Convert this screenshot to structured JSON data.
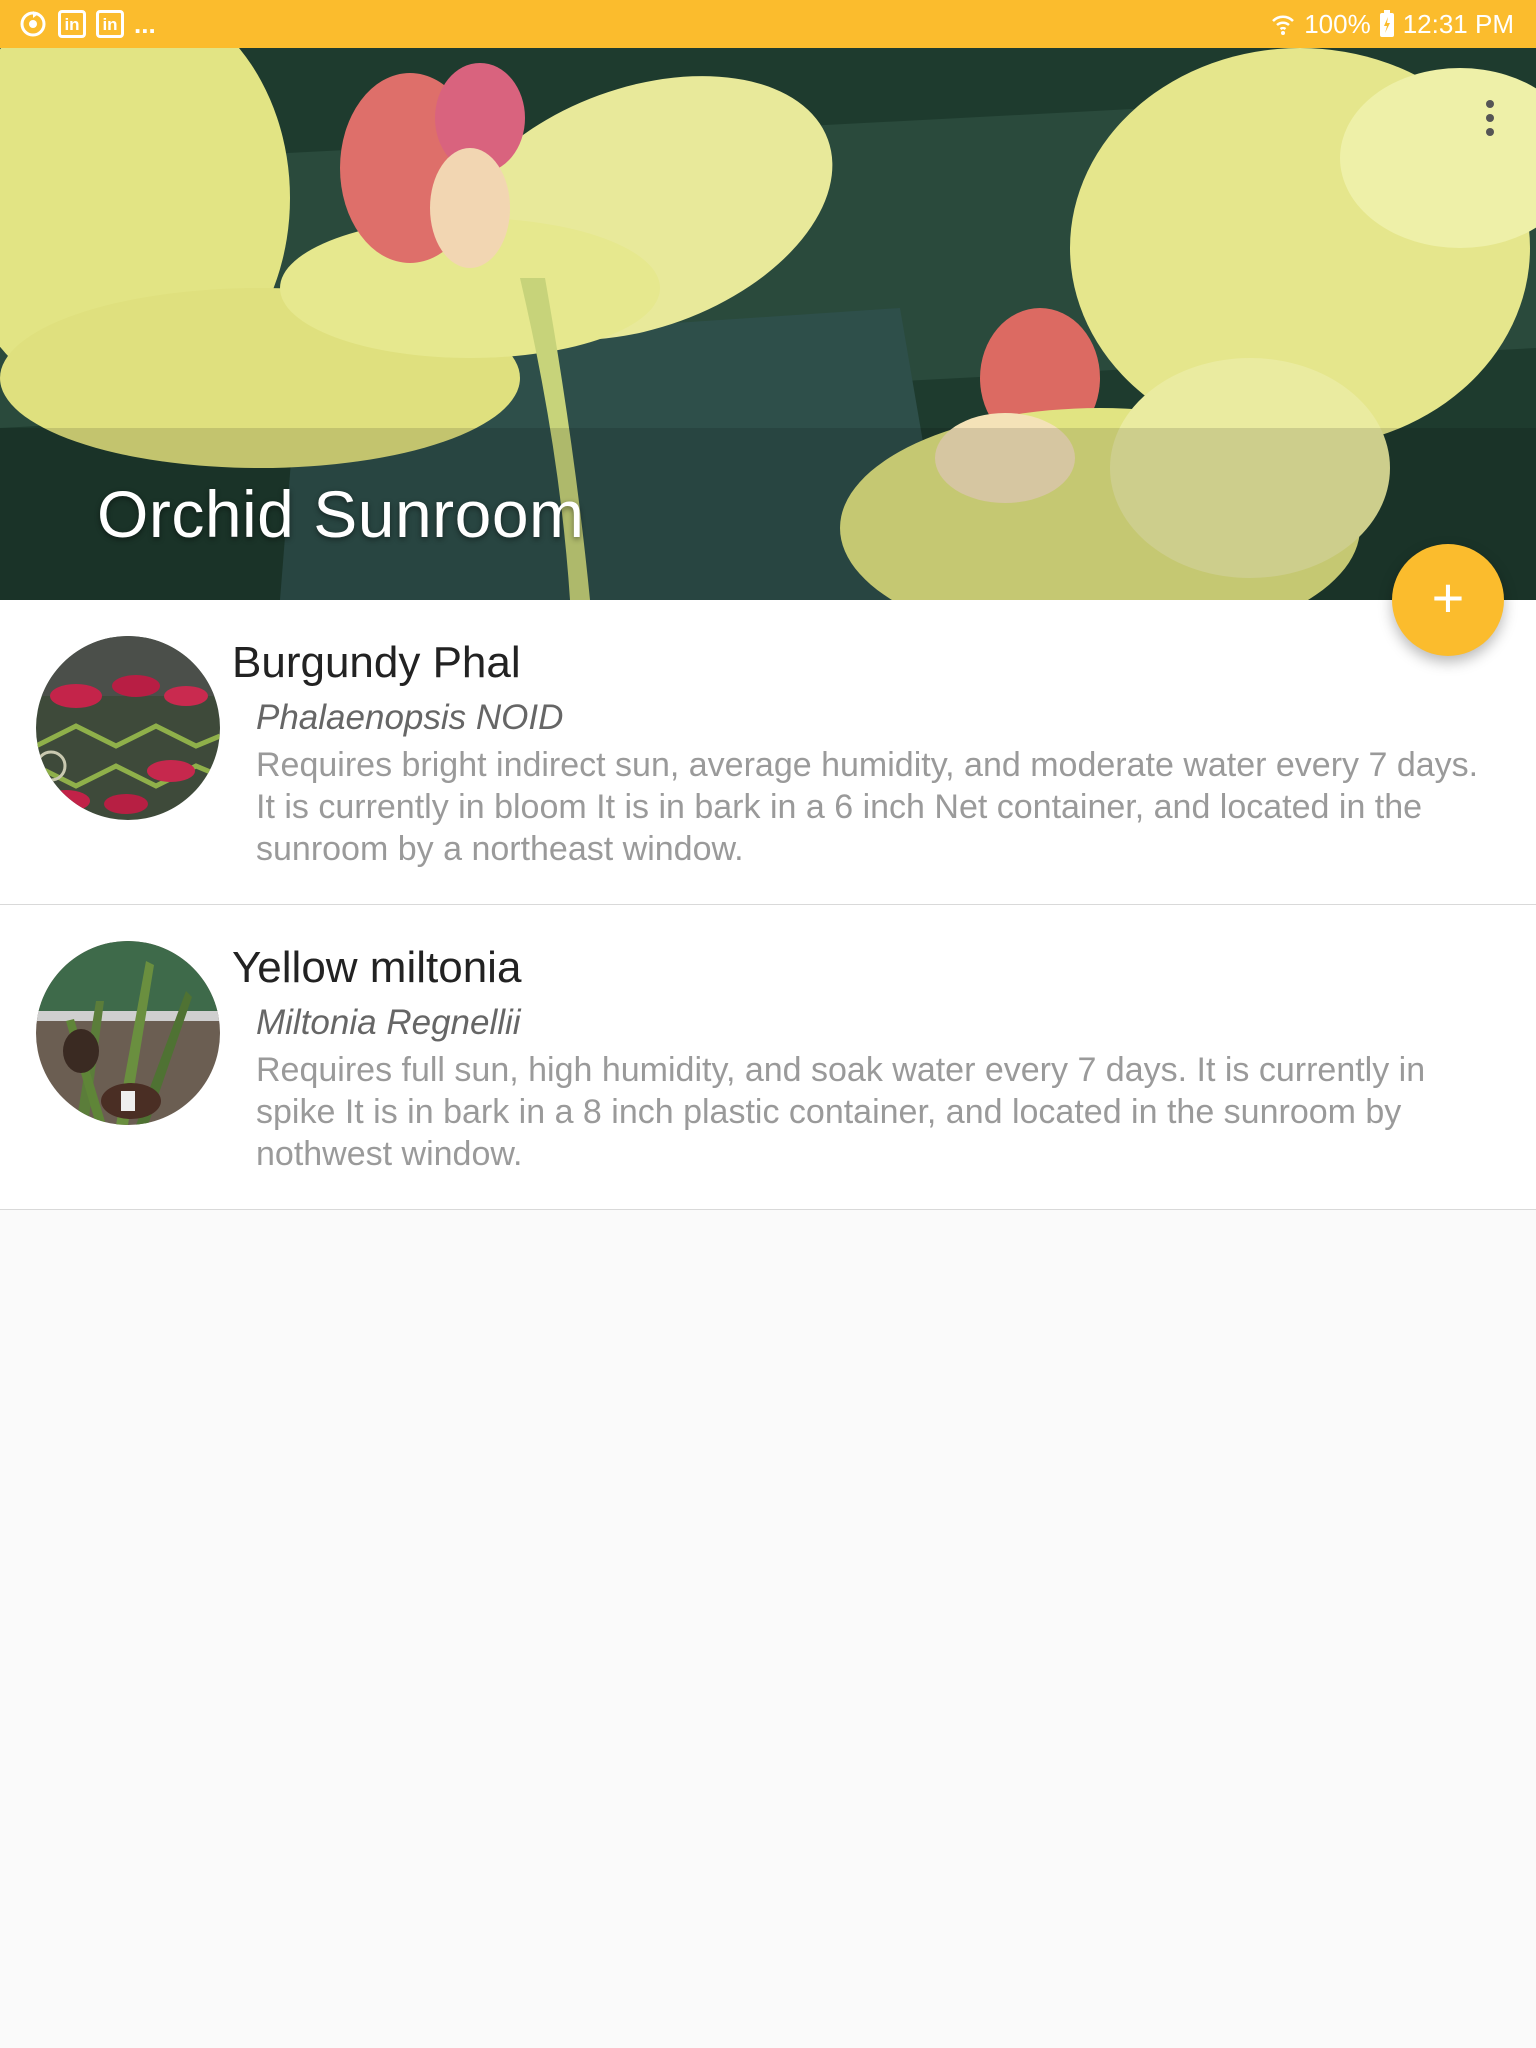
{
  "status_bar": {
    "left_icons": [
      "sync-icon",
      "linkedin-icon",
      "linkedin-icon"
    ],
    "more": "...",
    "battery": "100%",
    "time": "12:31 PM"
  },
  "header": {
    "title": "Orchid Sunroom",
    "menu_icon": "more-vert-icon"
  },
  "fab": {
    "icon": "add-icon",
    "label": "+"
  },
  "plants": [
    {
      "name": "Burgundy Phal",
      "species": "Phalaenopsis NOID",
      "description": "Requires bright indirect sun, average humidity, and moderate water every 7 days.  It is currently in bloom It is  in bark in a 6 inch Net container,  and located in the sunroom by a northeast window."
    },
    {
      "name": "Yellow miltonia",
      "species": "Miltonia Regnellii",
      "description": "Requires full sun, high humidity, and soak water every 7 days.  It is currently in spike It is  in bark in a 8 inch plastic container,  and located in the sunroom by nothwest window."
    }
  ],
  "colors": {
    "accent": "#fbbc2d",
    "title_text": "#ffffff",
    "name_text": "#222222",
    "species_text": "#666666",
    "desc_text": "#9a9a9a"
  }
}
